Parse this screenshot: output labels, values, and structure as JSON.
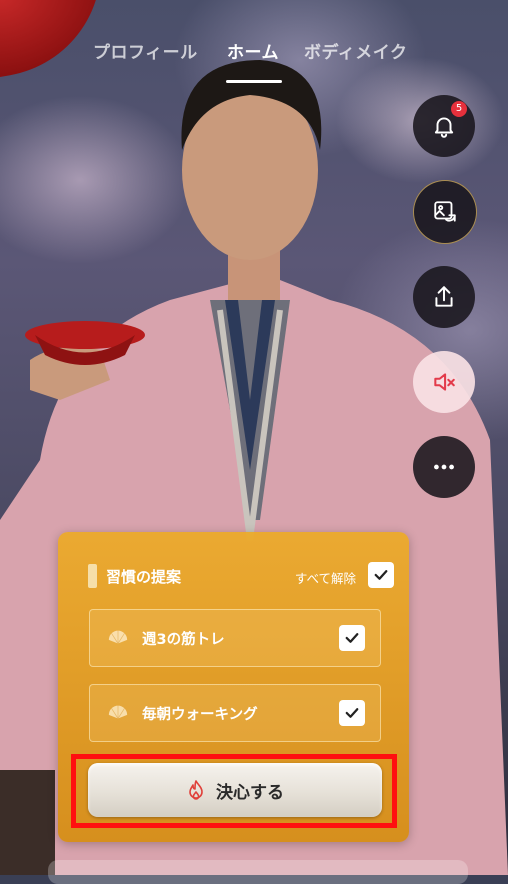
{
  "top_tabs": [
    {
      "label": "プロフィール",
      "active": false
    },
    {
      "label": "ホーム",
      "active": true
    },
    {
      "label": "ボディメイク",
      "active": false
    }
  ],
  "side_actions": {
    "notifications": {
      "icon": "bell-icon",
      "badge": "5"
    },
    "photo_swap": {
      "icon": "image-swap-icon"
    },
    "share": {
      "icon": "share-icon"
    },
    "mute": {
      "icon": "speaker-muted-icon"
    },
    "more": {
      "icon": "more-dots-icon"
    }
  },
  "habit_panel": {
    "title": "習慣の提案",
    "clear_all_label": "すべて解除",
    "clear_all_checked": true,
    "items": [
      {
        "icon": "fan-icon",
        "label": "週3の筋トレ",
        "checked": true
      },
      {
        "icon": "fan-icon",
        "label": "毎朝ウォーキング",
        "checked": true
      }
    ],
    "decide_button": {
      "icon": "flame-icon",
      "label": "決心する"
    }
  },
  "colors": {
    "panel": "#e5a526",
    "highlight": "#ff1010",
    "badge": "#e5303c"
  }
}
